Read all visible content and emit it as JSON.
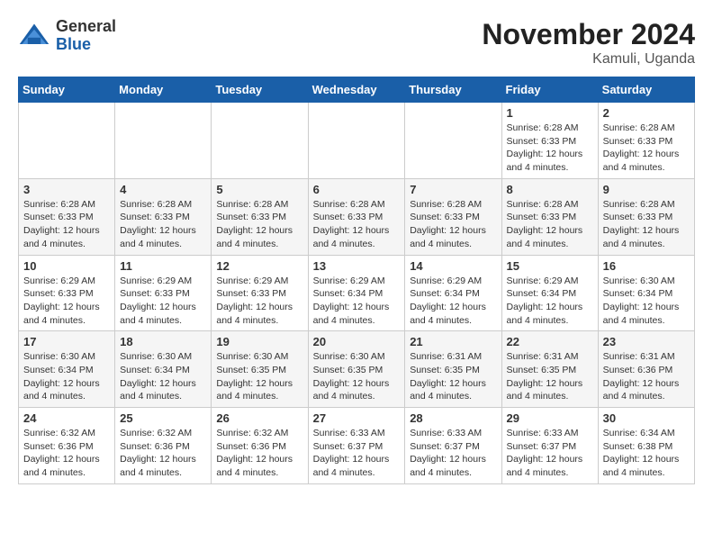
{
  "header": {
    "logo_general": "General",
    "logo_blue": "Blue",
    "month_title": "November 2024",
    "location": "Kamuli, Uganda"
  },
  "days_of_week": [
    "Sunday",
    "Monday",
    "Tuesday",
    "Wednesday",
    "Thursday",
    "Friday",
    "Saturday"
  ],
  "weeks": [
    [
      {
        "day": "",
        "sunrise": "",
        "sunset": "",
        "daylight": ""
      },
      {
        "day": "",
        "sunrise": "",
        "sunset": "",
        "daylight": ""
      },
      {
        "day": "",
        "sunrise": "",
        "sunset": "",
        "daylight": ""
      },
      {
        "day": "",
        "sunrise": "",
        "sunset": "",
        "daylight": ""
      },
      {
        "day": "",
        "sunrise": "",
        "sunset": "",
        "daylight": ""
      },
      {
        "day": "1",
        "sunrise": "Sunrise: 6:28 AM",
        "sunset": "Sunset: 6:33 PM",
        "daylight": "Daylight: 12 hours and 4 minutes."
      },
      {
        "day": "2",
        "sunrise": "Sunrise: 6:28 AM",
        "sunset": "Sunset: 6:33 PM",
        "daylight": "Daylight: 12 hours and 4 minutes."
      }
    ],
    [
      {
        "day": "3",
        "sunrise": "Sunrise: 6:28 AM",
        "sunset": "Sunset: 6:33 PM",
        "daylight": "Daylight: 12 hours and 4 minutes."
      },
      {
        "day": "4",
        "sunrise": "Sunrise: 6:28 AM",
        "sunset": "Sunset: 6:33 PM",
        "daylight": "Daylight: 12 hours and 4 minutes."
      },
      {
        "day": "5",
        "sunrise": "Sunrise: 6:28 AM",
        "sunset": "Sunset: 6:33 PM",
        "daylight": "Daylight: 12 hours and 4 minutes."
      },
      {
        "day": "6",
        "sunrise": "Sunrise: 6:28 AM",
        "sunset": "Sunset: 6:33 PM",
        "daylight": "Daylight: 12 hours and 4 minutes."
      },
      {
        "day": "7",
        "sunrise": "Sunrise: 6:28 AM",
        "sunset": "Sunset: 6:33 PM",
        "daylight": "Daylight: 12 hours and 4 minutes."
      },
      {
        "day": "8",
        "sunrise": "Sunrise: 6:28 AM",
        "sunset": "Sunset: 6:33 PM",
        "daylight": "Daylight: 12 hours and 4 minutes."
      },
      {
        "day": "9",
        "sunrise": "Sunrise: 6:28 AM",
        "sunset": "Sunset: 6:33 PM",
        "daylight": "Daylight: 12 hours and 4 minutes."
      }
    ],
    [
      {
        "day": "10",
        "sunrise": "Sunrise: 6:29 AM",
        "sunset": "Sunset: 6:33 PM",
        "daylight": "Daylight: 12 hours and 4 minutes."
      },
      {
        "day": "11",
        "sunrise": "Sunrise: 6:29 AM",
        "sunset": "Sunset: 6:33 PM",
        "daylight": "Daylight: 12 hours and 4 minutes."
      },
      {
        "day": "12",
        "sunrise": "Sunrise: 6:29 AM",
        "sunset": "Sunset: 6:33 PM",
        "daylight": "Daylight: 12 hours and 4 minutes."
      },
      {
        "day": "13",
        "sunrise": "Sunrise: 6:29 AM",
        "sunset": "Sunset: 6:34 PM",
        "daylight": "Daylight: 12 hours and 4 minutes."
      },
      {
        "day": "14",
        "sunrise": "Sunrise: 6:29 AM",
        "sunset": "Sunset: 6:34 PM",
        "daylight": "Daylight: 12 hours and 4 minutes."
      },
      {
        "day": "15",
        "sunrise": "Sunrise: 6:29 AM",
        "sunset": "Sunset: 6:34 PM",
        "daylight": "Daylight: 12 hours and 4 minutes."
      },
      {
        "day": "16",
        "sunrise": "Sunrise: 6:30 AM",
        "sunset": "Sunset: 6:34 PM",
        "daylight": "Daylight: 12 hours and 4 minutes."
      }
    ],
    [
      {
        "day": "17",
        "sunrise": "Sunrise: 6:30 AM",
        "sunset": "Sunset: 6:34 PM",
        "daylight": "Daylight: 12 hours and 4 minutes."
      },
      {
        "day": "18",
        "sunrise": "Sunrise: 6:30 AM",
        "sunset": "Sunset: 6:34 PM",
        "daylight": "Daylight: 12 hours and 4 minutes."
      },
      {
        "day": "19",
        "sunrise": "Sunrise: 6:30 AM",
        "sunset": "Sunset: 6:35 PM",
        "daylight": "Daylight: 12 hours and 4 minutes."
      },
      {
        "day": "20",
        "sunrise": "Sunrise: 6:30 AM",
        "sunset": "Sunset: 6:35 PM",
        "daylight": "Daylight: 12 hours and 4 minutes."
      },
      {
        "day": "21",
        "sunrise": "Sunrise: 6:31 AM",
        "sunset": "Sunset: 6:35 PM",
        "daylight": "Daylight: 12 hours and 4 minutes."
      },
      {
        "day": "22",
        "sunrise": "Sunrise: 6:31 AM",
        "sunset": "Sunset: 6:35 PM",
        "daylight": "Daylight: 12 hours and 4 minutes."
      },
      {
        "day": "23",
        "sunrise": "Sunrise: 6:31 AM",
        "sunset": "Sunset: 6:36 PM",
        "daylight": "Daylight: 12 hours and 4 minutes."
      }
    ],
    [
      {
        "day": "24",
        "sunrise": "Sunrise: 6:32 AM",
        "sunset": "Sunset: 6:36 PM",
        "daylight": "Daylight: 12 hours and 4 minutes."
      },
      {
        "day": "25",
        "sunrise": "Sunrise: 6:32 AM",
        "sunset": "Sunset: 6:36 PM",
        "daylight": "Daylight: 12 hours and 4 minutes."
      },
      {
        "day": "26",
        "sunrise": "Sunrise: 6:32 AM",
        "sunset": "Sunset: 6:36 PM",
        "daylight": "Daylight: 12 hours and 4 minutes."
      },
      {
        "day": "27",
        "sunrise": "Sunrise: 6:33 AM",
        "sunset": "Sunset: 6:37 PM",
        "daylight": "Daylight: 12 hours and 4 minutes."
      },
      {
        "day": "28",
        "sunrise": "Sunrise: 6:33 AM",
        "sunset": "Sunset: 6:37 PM",
        "daylight": "Daylight: 12 hours and 4 minutes."
      },
      {
        "day": "29",
        "sunrise": "Sunrise: 6:33 AM",
        "sunset": "Sunset: 6:37 PM",
        "daylight": "Daylight: 12 hours and 4 minutes."
      },
      {
        "day": "30",
        "sunrise": "Sunrise: 6:34 AM",
        "sunset": "Sunset: 6:38 PM",
        "daylight": "Daylight: 12 hours and 4 minutes."
      }
    ]
  ]
}
